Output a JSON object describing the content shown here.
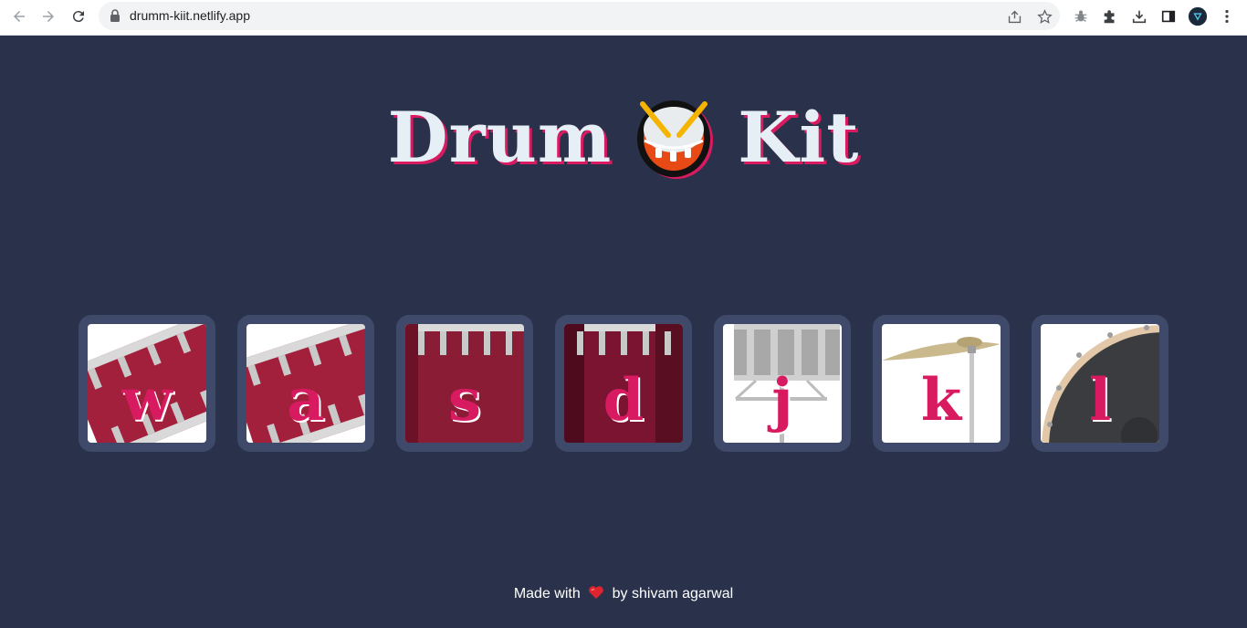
{
  "browser": {
    "url": "drumm-kiit.netlify.app"
  },
  "page": {
    "title_left": "Drum",
    "title_right": "Kit",
    "keys": [
      {
        "letter": "w"
      },
      {
        "letter": "a"
      },
      {
        "letter": "s"
      },
      {
        "letter": "d"
      },
      {
        "letter": "j"
      },
      {
        "letter": "k"
      },
      {
        "letter": "l"
      }
    ],
    "footer": {
      "prefix": "Made with",
      "suffix": "by shivam agarwal"
    }
  },
  "colors": {
    "background": "#2a324b",
    "key_frame": "#3f4a6b",
    "accent": "#d81b60",
    "title": "#e6eef6"
  }
}
